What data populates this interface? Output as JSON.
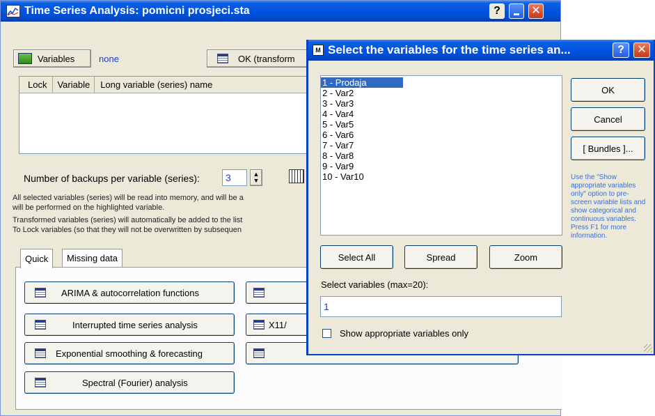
{
  "main_window": {
    "title": "Time Series Analysis: pomicni prosjeci.sta",
    "variables_button": "Variables",
    "variables_value": "none",
    "ok_button": "OK (transform",
    "table_headers": [
      "Lock",
      "Variable",
      "Long variable (series) name"
    ],
    "backups_label": "Number of backups per variable (series):",
    "backups_value": "3",
    "info_lines": [
      "All selected variables (series) will be read into memory, and will be a",
      "will be performed on the highlighted variable.",
      "Transformed variables (series) will automatically be added to the list",
      "To Lock variables (so that they will not be overwritten by subsequen"
    ],
    "tabs": [
      "Quick",
      "Missing data"
    ],
    "buttons": {
      "arima": "ARIMA & autocorrelation functions",
      "interrupted": "Interrupted time series analysis",
      "exponential": "Exponential smoothing & forecasting",
      "spectral": "Spectral (Fourier) analysis",
      "x11": "X11/"
    }
  },
  "dialog": {
    "title": "Select the variables for the time series an...",
    "variables": [
      "1 - Prodaja",
      "2 - Var2",
      "3 - Var3",
      "4 - Var4",
      "5 - Var5",
      "6 - Var6",
      "7 - Var7",
      "8 - Var8",
      "9 - Var9",
      "10 - Var10"
    ],
    "selected_index": 0,
    "ok": "OK",
    "cancel": "Cancel",
    "bundles": "[ Bundles ]...",
    "help_text": "Use the \"Show appropriate variables only\" option to pre-screen variable lists and show categorical and continuous variables. Press F1 for more information.",
    "select_all": "Select All",
    "spread": "Spread",
    "zoom": "Zoom",
    "select_label": "Select variables (max=20):",
    "select_value": "1",
    "show_appropriate": "Show appropriate variables only"
  },
  "colors": {
    "titlebar": "#0054e3",
    "selection": "#316ac5",
    "help_text": "#3a6fd8",
    "face": "#ece9d8"
  }
}
